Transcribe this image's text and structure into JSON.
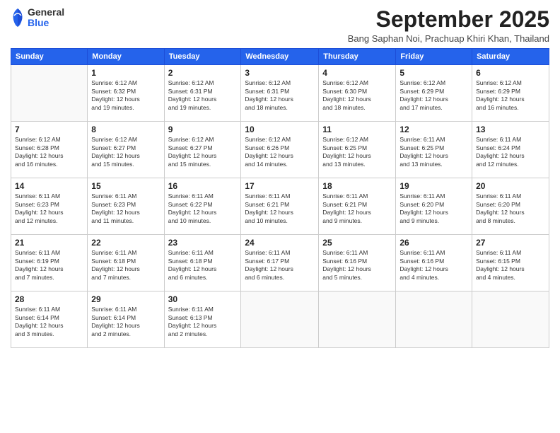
{
  "logo": {
    "general": "General",
    "blue": "Blue"
  },
  "title": "September 2025",
  "location": "Bang Saphan Noi, Prachuap Khiri Khan, Thailand",
  "days_of_week": [
    "Sunday",
    "Monday",
    "Tuesday",
    "Wednesday",
    "Thursday",
    "Friday",
    "Saturday"
  ],
  "weeks": [
    [
      {
        "num": "",
        "info": ""
      },
      {
        "num": "1",
        "info": "Sunrise: 6:12 AM\nSunset: 6:32 PM\nDaylight: 12 hours\nand 19 minutes."
      },
      {
        "num": "2",
        "info": "Sunrise: 6:12 AM\nSunset: 6:31 PM\nDaylight: 12 hours\nand 19 minutes."
      },
      {
        "num": "3",
        "info": "Sunrise: 6:12 AM\nSunset: 6:31 PM\nDaylight: 12 hours\nand 18 minutes."
      },
      {
        "num": "4",
        "info": "Sunrise: 6:12 AM\nSunset: 6:30 PM\nDaylight: 12 hours\nand 18 minutes."
      },
      {
        "num": "5",
        "info": "Sunrise: 6:12 AM\nSunset: 6:29 PM\nDaylight: 12 hours\nand 17 minutes."
      },
      {
        "num": "6",
        "info": "Sunrise: 6:12 AM\nSunset: 6:29 PM\nDaylight: 12 hours\nand 16 minutes."
      }
    ],
    [
      {
        "num": "7",
        "info": "Sunrise: 6:12 AM\nSunset: 6:28 PM\nDaylight: 12 hours\nand 16 minutes."
      },
      {
        "num": "8",
        "info": "Sunrise: 6:12 AM\nSunset: 6:27 PM\nDaylight: 12 hours\nand 15 minutes."
      },
      {
        "num": "9",
        "info": "Sunrise: 6:12 AM\nSunset: 6:27 PM\nDaylight: 12 hours\nand 15 minutes."
      },
      {
        "num": "10",
        "info": "Sunrise: 6:12 AM\nSunset: 6:26 PM\nDaylight: 12 hours\nand 14 minutes."
      },
      {
        "num": "11",
        "info": "Sunrise: 6:12 AM\nSunset: 6:25 PM\nDaylight: 12 hours\nand 13 minutes."
      },
      {
        "num": "12",
        "info": "Sunrise: 6:11 AM\nSunset: 6:25 PM\nDaylight: 12 hours\nand 13 minutes."
      },
      {
        "num": "13",
        "info": "Sunrise: 6:11 AM\nSunset: 6:24 PM\nDaylight: 12 hours\nand 12 minutes."
      }
    ],
    [
      {
        "num": "14",
        "info": "Sunrise: 6:11 AM\nSunset: 6:23 PM\nDaylight: 12 hours\nand 12 minutes."
      },
      {
        "num": "15",
        "info": "Sunrise: 6:11 AM\nSunset: 6:23 PM\nDaylight: 12 hours\nand 11 minutes."
      },
      {
        "num": "16",
        "info": "Sunrise: 6:11 AM\nSunset: 6:22 PM\nDaylight: 12 hours\nand 10 minutes."
      },
      {
        "num": "17",
        "info": "Sunrise: 6:11 AM\nSunset: 6:21 PM\nDaylight: 12 hours\nand 10 minutes."
      },
      {
        "num": "18",
        "info": "Sunrise: 6:11 AM\nSunset: 6:21 PM\nDaylight: 12 hours\nand 9 minutes."
      },
      {
        "num": "19",
        "info": "Sunrise: 6:11 AM\nSunset: 6:20 PM\nDaylight: 12 hours\nand 9 minutes."
      },
      {
        "num": "20",
        "info": "Sunrise: 6:11 AM\nSunset: 6:20 PM\nDaylight: 12 hours\nand 8 minutes."
      }
    ],
    [
      {
        "num": "21",
        "info": "Sunrise: 6:11 AM\nSunset: 6:19 PM\nDaylight: 12 hours\nand 7 minutes."
      },
      {
        "num": "22",
        "info": "Sunrise: 6:11 AM\nSunset: 6:18 PM\nDaylight: 12 hours\nand 7 minutes."
      },
      {
        "num": "23",
        "info": "Sunrise: 6:11 AM\nSunset: 6:18 PM\nDaylight: 12 hours\nand 6 minutes."
      },
      {
        "num": "24",
        "info": "Sunrise: 6:11 AM\nSunset: 6:17 PM\nDaylight: 12 hours\nand 6 minutes."
      },
      {
        "num": "25",
        "info": "Sunrise: 6:11 AM\nSunset: 6:16 PM\nDaylight: 12 hours\nand 5 minutes."
      },
      {
        "num": "26",
        "info": "Sunrise: 6:11 AM\nSunset: 6:16 PM\nDaylight: 12 hours\nand 4 minutes."
      },
      {
        "num": "27",
        "info": "Sunrise: 6:11 AM\nSunset: 6:15 PM\nDaylight: 12 hours\nand 4 minutes."
      }
    ],
    [
      {
        "num": "28",
        "info": "Sunrise: 6:11 AM\nSunset: 6:14 PM\nDaylight: 12 hours\nand 3 minutes."
      },
      {
        "num": "29",
        "info": "Sunrise: 6:11 AM\nSunset: 6:14 PM\nDaylight: 12 hours\nand 2 minutes."
      },
      {
        "num": "30",
        "info": "Sunrise: 6:11 AM\nSunset: 6:13 PM\nDaylight: 12 hours\nand 2 minutes."
      },
      {
        "num": "",
        "info": ""
      },
      {
        "num": "",
        "info": ""
      },
      {
        "num": "",
        "info": ""
      },
      {
        "num": "",
        "info": ""
      }
    ]
  ]
}
